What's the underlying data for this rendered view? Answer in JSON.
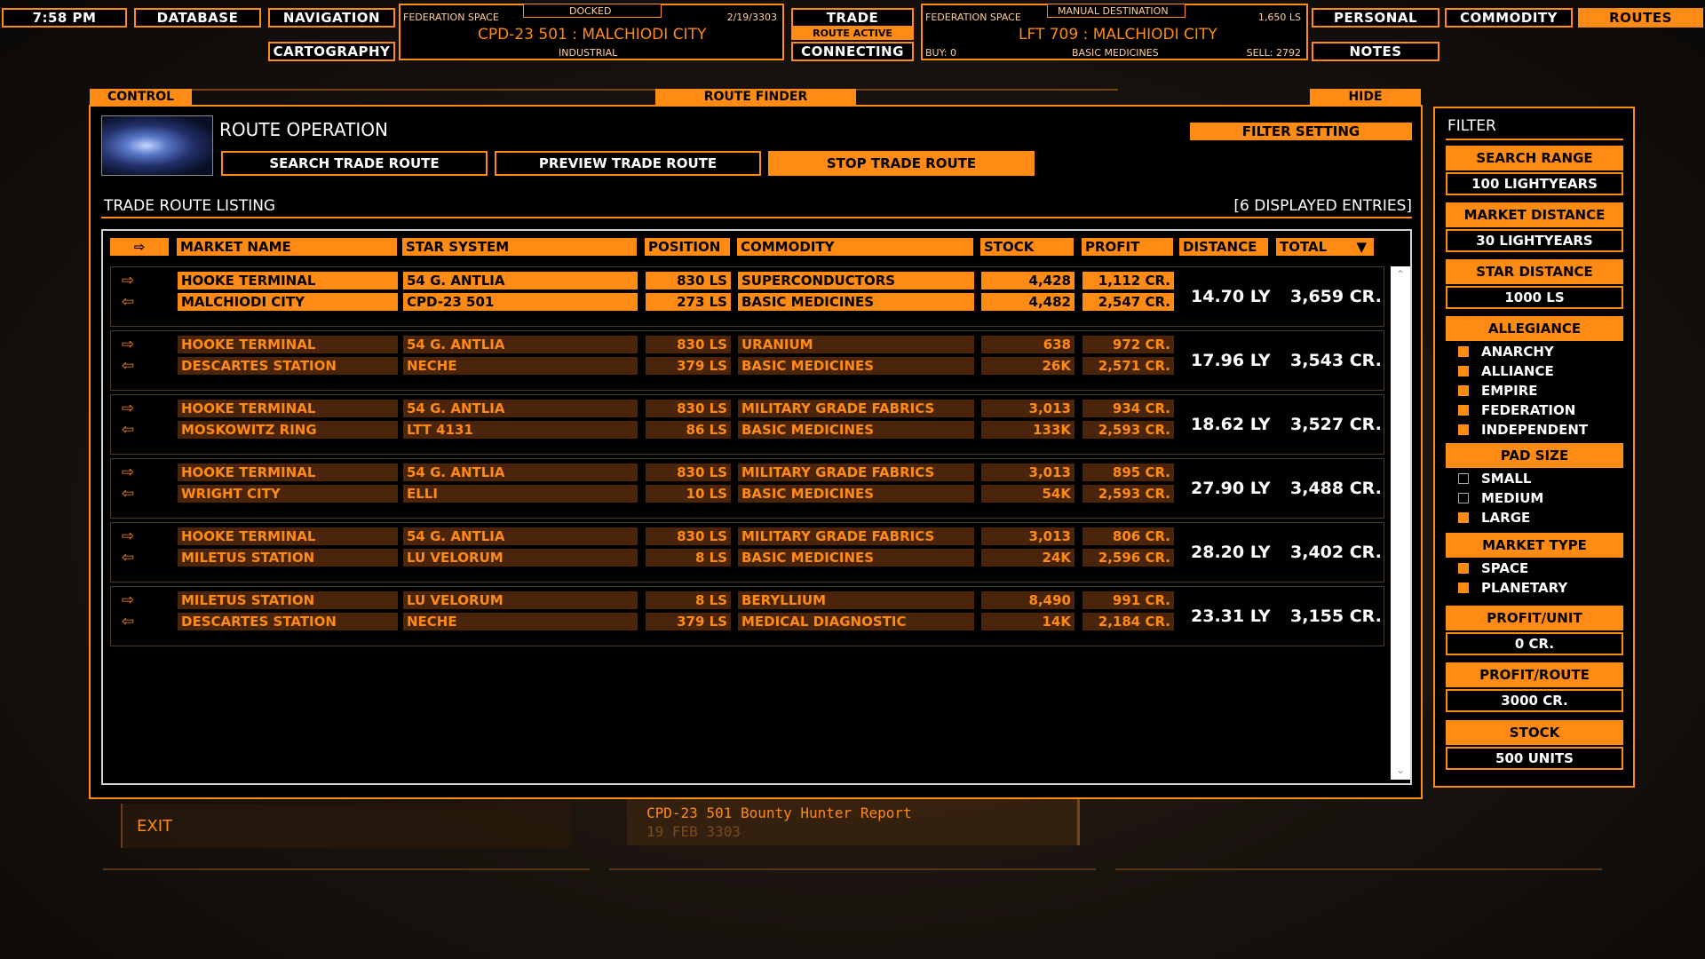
{
  "topbar": {
    "time": "7:58 PM",
    "database": "DATABASE",
    "navigation": "NAVIGATION",
    "cartography": "CARTOGRAPHY",
    "trade": "TRADE",
    "route_active": "ROUTE ACTIVE",
    "connecting": "CONNECTING",
    "personal": "PERSONAL",
    "commodity": "COMMODITY",
    "routes": "ROUTES",
    "notes": "NOTES",
    "current": {
      "status": "DOCKED",
      "region": "FEDERATION SPACE",
      "date": "2/19/3303",
      "name": "CPD-23 501 : MALCHIODI CITY",
      "economy": "INDUSTRIAL"
    },
    "destination": {
      "status": "MANUAL DESTINATION",
      "region": "FEDERATION SPACE",
      "distance": "1,650 LS",
      "name": "LFT 709 : MALCHIODI CITY",
      "buy": "BUY: 0",
      "commodity": "BASIC MEDICINES",
      "sell": "SELL: 2792"
    }
  },
  "tabs": {
    "control": "CONTROL",
    "route_finder": "ROUTE FINDER",
    "hide": "HIDE"
  },
  "route_operation": {
    "title": "ROUTE OPERATION",
    "filter_setting": "FILTER SETTING",
    "search": "SEARCH TRADE ROUTE",
    "preview": "PREVIEW TRADE ROUTE",
    "stop": "STOP TRADE ROUTE"
  },
  "listing": {
    "title": "TRADE ROUTE LISTING",
    "count": "[6 DISPLAYED ENTRIES]",
    "headers": {
      "arrow": "⇨",
      "market": "MARKET NAME",
      "system": "STAR SYSTEM",
      "position": "POSITION",
      "commodity": "COMMODITY",
      "stock": "STOCK",
      "profit": "PROFIT",
      "distance": "DISTANCE",
      "total": "TOTAL",
      "sort_icon": "▼"
    },
    "routes": [
      {
        "out": {
          "market": "HOOKE TERMINAL",
          "system": "54 G. ANTLIA",
          "position": "830 LS",
          "commodity": "SUPERCONDUCTORS",
          "stock": "4,428",
          "profit": "1,112 CR."
        },
        "back": {
          "market": "MALCHIODI CITY",
          "system": "CPD-23 501",
          "position": "273 LS",
          "commodity": "BASIC MEDICINES",
          "stock": "4,482",
          "profit": "2,547 CR."
        },
        "distance": "14.70 LY",
        "total": "3,659 CR."
      },
      {
        "out": {
          "market": "HOOKE TERMINAL",
          "system": "54 G. ANTLIA",
          "position": "830 LS",
          "commodity": "URANIUM",
          "stock": "638",
          "profit": "972 CR."
        },
        "back": {
          "market": "DESCARTES STATION",
          "system": "NECHE",
          "position": "379 LS",
          "commodity": "BASIC MEDICINES",
          "stock": "26K",
          "profit": "2,571 CR."
        },
        "distance": "17.96 LY",
        "total": "3,543 CR."
      },
      {
        "out": {
          "market": "HOOKE TERMINAL",
          "system": "54 G. ANTLIA",
          "position": "830 LS",
          "commodity": "MILITARY GRADE FABRICS",
          "stock": "3,013",
          "profit": "934 CR."
        },
        "back": {
          "market": "MOSKOWITZ RING",
          "system": "LTT 4131",
          "position": "86 LS",
          "commodity": "BASIC MEDICINES",
          "stock": "133K",
          "profit": "2,593 CR."
        },
        "distance": "18.62 LY",
        "total": "3,527 CR."
      },
      {
        "out": {
          "market": "HOOKE TERMINAL",
          "system": "54 G. ANTLIA",
          "position": "830 LS",
          "commodity": "MILITARY GRADE FABRICS",
          "stock": "3,013",
          "profit": "895 CR."
        },
        "back": {
          "market": "WRIGHT CITY",
          "system": "ELLI",
          "position": "10 LS",
          "commodity": "BASIC MEDICINES",
          "stock": "54K",
          "profit": "2,593 CR."
        },
        "distance": "27.90 LY",
        "total": "3,488 CR."
      },
      {
        "out": {
          "market": "HOOKE TERMINAL",
          "system": "54 G. ANTLIA",
          "position": "830 LS",
          "commodity": "MILITARY GRADE FABRICS",
          "stock": "3,013",
          "profit": "806 CR."
        },
        "back": {
          "market": "MILETUS STATION",
          "system": "LU VELORUM",
          "position": "8 LS",
          "commodity": "BASIC MEDICINES",
          "stock": "24K",
          "profit": "2,596 CR."
        },
        "distance": "28.20 LY",
        "total": "3,402 CR."
      },
      {
        "out": {
          "market": "MILETUS STATION",
          "system": "LU VELORUM",
          "position": "8 LS",
          "commodity": "BERYLLIUM",
          "stock": "8,490",
          "profit": "991 CR."
        },
        "back": {
          "market": "DESCARTES STATION",
          "system": "NECHE",
          "position": "379 LS",
          "commodity": "MEDICAL DIAGNOSTIC",
          "stock": "14K",
          "profit": "2,184 CR."
        },
        "distance": "23.31 LY",
        "total": "3,155 CR."
      }
    ],
    "arrow_out": "⇨",
    "arrow_back": "⇦",
    "scroll_up": "⌃",
    "scroll_down": "⌄"
  },
  "filter": {
    "title": "FILTER",
    "search_range_label": "SEARCH RANGE",
    "search_range_value": "100 LIGHTYEARS",
    "market_distance_label": "MARKET DISTANCE",
    "market_distance_value": "30 LIGHTYEARS",
    "star_distance_label": "STAR DISTANCE",
    "star_distance_value": "1000 LS",
    "allegiance_label": "ALLEGIANCE",
    "allegiance": [
      {
        "label": "ANARCHY",
        "checked": true
      },
      {
        "label": "ALLIANCE",
        "checked": true
      },
      {
        "label": "EMPIRE",
        "checked": true
      },
      {
        "label": "FEDERATION",
        "checked": true
      },
      {
        "label": "INDEPENDENT",
        "checked": true
      }
    ],
    "pad_size_label": "PAD SIZE",
    "pad_size": [
      {
        "label": "SMALL",
        "checked": false
      },
      {
        "label": "MEDIUM",
        "checked": false
      },
      {
        "label": "LARGE",
        "checked": true
      }
    ],
    "market_type_label": "MARKET TYPE",
    "market_type": [
      {
        "label": "SPACE",
        "checked": true
      },
      {
        "label": "PLANETARY",
        "checked": true
      }
    ],
    "profit_unit_label": "PROFIT/UNIT",
    "profit_unit_value": "0 CR.",
    "profit_route_label": "PROFIT/ROUTE",
    "profit_route_value": "3000 CR.",
    "stock_label": "STOCK",
    "stock_value": "500 UNITS"
  },
  "bottom": {
    "exit": "EXIT",
    "report_title": "CPD-23 501 Bounty Hunter Report",
    "report_date": "19 FEB 3303"
  },
  "colors": {
    "accent": "#ff8a14",
    "text": "#ffffff",
    "background": "#000000"
  }
}
